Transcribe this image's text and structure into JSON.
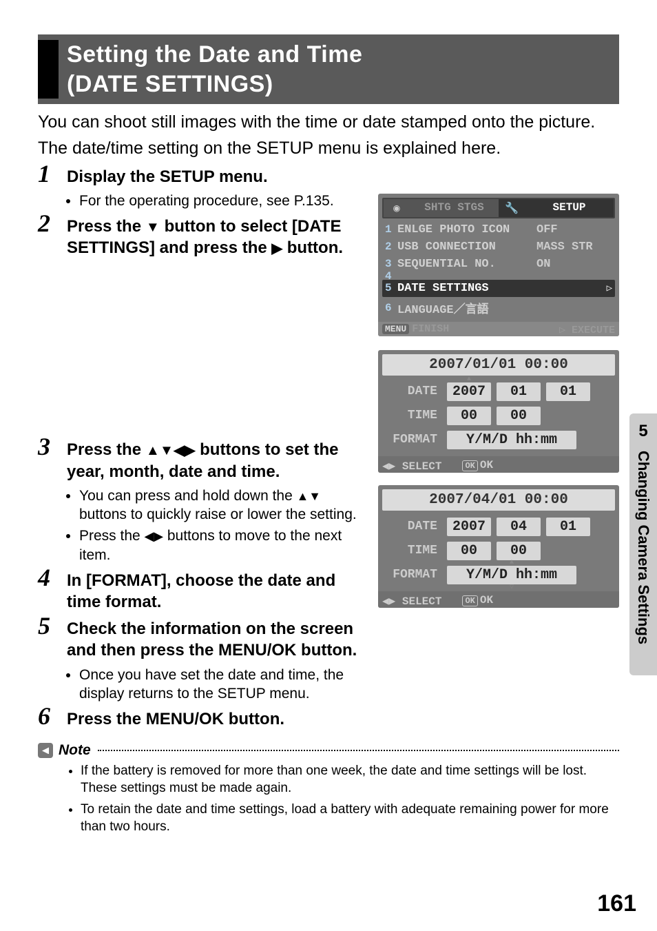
{
  "page_number": "161",
  "side_tab": {
    "chapter": "5",
    "text": "Changing Camera Settings"
  },
  "title": {
    "line1": "Setting the Date and Time",
    "line2": "(DATE SETTINGS)"
  },
  "intro": {
    "p1": "You can shoot still images with the time or date stamped onto the picture.",
    "p2": "The date/time setting on the SETUP menu is explained here."
  },
  "steps": {
    "s1": {
      "num": "1",
      "title": "Display the SETUP menu.",
      "b1": "For the operating procedure, see P.135."
    },
    "s2": {
      "num": "2",
      "title_a": "Press the ",
      "title_b": " button to select [DATE SETTINGS] and press the ",
      "title_c": " button."
    },
    "s3": {
      "num": "3",
      "title_a": "Press the ",
      "title_b": " buttons to set the year, month, date and time.",
      "b1a": "You can press and hold down the ",
      "b1b": " buttons to quickly raise or lower the setting.",
      "b2a": "Press the ",
      "b2b": " buttons to move to the next item."
    },
    "s4": {
      "num": "4",
      "title": "In [FORMAT], choose the date and time format."
    },
    "s5": {
      "num": "5",
      "title": "Check the information on the screen and then press the MENU/OK button.",
      "b1": "Once you have set the date and time, the display returns to the SETUP menu."
    },
    "s6": {
      "num": "6",
      "title": "Press the MENU/OK button."
    }
  },
  "note": {
    "label": "Note",
    "b1": "If the battery is removed for more than one week, the date and time settings will be lost. These settings must be made again.",
    "b2": "To retain the date and time settings, load a battery with adequate remaining power for more than two hours."
  },
  "setup_screen": {
    "tab1": "SHTG STGS",
    "tab2": "SETUP",
    "items": [
      {
        "n": "1",
        "label": "ENLGE PHOTO ICON",
        "val": "OFF"
      },
      {
        "n": "2",
        "label": "USB CONNECTION",
        "val": "MASS STR"
      },
      {
        "n": "3",
        "label": "SEQUENTIAL NO.",
        "val": "ON"
      }
    ],
    "sel": {
      "n": "5",
      "label": "DATE SETTINGS",
      "chev": "▷"
    },
    "n4": "4",
    "lang": {
      "n": "6",
      "label": "LANGUAGE／言語"
    },
    "footer": {
      "finish": "FINISH",
      "exec": "▷ EXECUTE",
      "menu": "MENU"
    }
  },
  "date_screen_a": {
    "header": "2007/01/01 00:00",
    "rows": {
      "date": {
        "lab": "DATE",
        "y": "2007",
        "m": "01",
        "d": "01"
      },
      "time": {
        "lab": "TIME",
        "h": "00",
        "min": "00"
      },
      "format": {
        "lab": "FORMAT",
        "val": "Y/M/D hh:mm"
      }
    },
    "footer": {
      "select": "SELECT",
      "ok": "OK"
    }
  },
  "date_screen_b": {
    "header": "2007/04/01 00:00",
    "rows": {
      "date": {
        "lab": "DATE",
        "y": "2007",
        "m": "04",
        "d": "01"
      },
      "time": {
        "lab": "TIME",
        "h": "00",
        "min": "00"
      },
      "format": {
        "lab": "FORMAT",
        "val": "Y/M/D hh:mm"
      }
    },
    "footer": {
      "select": "SELECT",
      "ok": "OK"
    }
  }
}
